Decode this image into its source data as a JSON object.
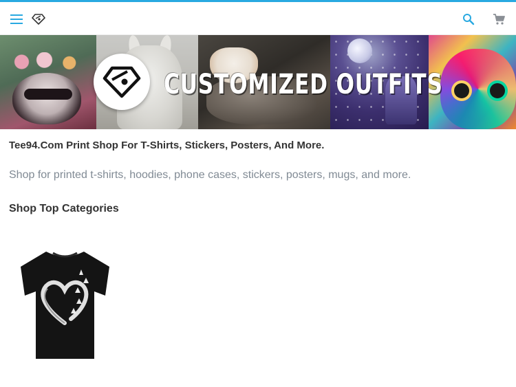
{
  "header": {
    "menu_icon": "hamburger-menu-icon",
    "logo_icon": "diamond-logo-icon",
    "search_icon": "search-icon",
    "cart_icon": "shopping-cart-icon",
    "accent_color": "#29a9e1"
  },
  "banner": {
    "title": "CUSTOMIZED OUTFITS",
    "badge_icon": "diamond-logo-icon"
  },
  "main": {
    "heading": "Tee94.Com Print Shop For T-Shirts, Stickers, Posters, And More.",
    "subtitle": "Shop for printed t-shirts, hoodies, phone cases, stickers, posters, mugs, and more.",
    "section_heading": "Shop Top Categories"
  },
  "categories": [
    {
      "image": "black-tshirt-heart-graphic"
    }
  ]
}
